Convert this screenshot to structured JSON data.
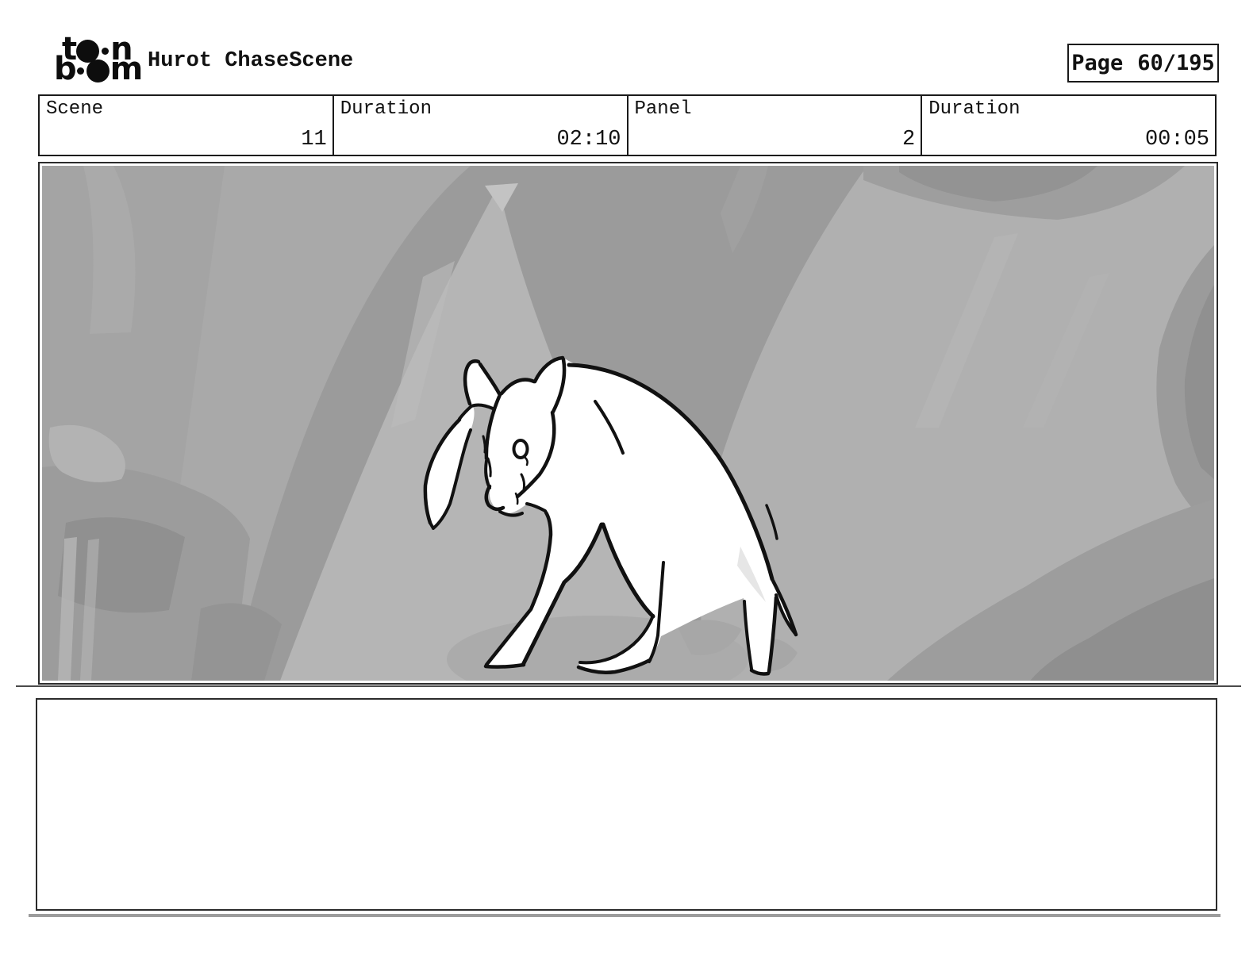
{
  "header": {
    "logo": {
      "row1_left": "t",
      "row1_right": "n",
      "row2_left": "b",
      "row2_right": "m"
    },
    "title": "Hurot ChaseScene",
    "page_label": "Page",
    "page_value": "60/195"
  },
  "info_bar": {
    "cells": [
      {
        "label": "Scene",
        "value": "11"
      },
      {
        "label": "Duration",
        "value": "02:10"
      },
      {
        "label": "Panel",
        "value": "2"
      },
      {
        "label": "Duration",
        "value": "00:05"
      }
    ]
  },
  "storyboard_panel": {
    "description_icon": "deer-sketch-drawing",
    "colors": {
      "background_base": "#a9a9a9",
      "background_dark": "#9b9b9b",
      "background_darker": "#8f8f8f",
      "background_light": "#b4b4b4",
      "line": "#111111",
      "figure_fill": "#ffffff"
    }
  },
  "caption": {
    "text": ""
  }
}
